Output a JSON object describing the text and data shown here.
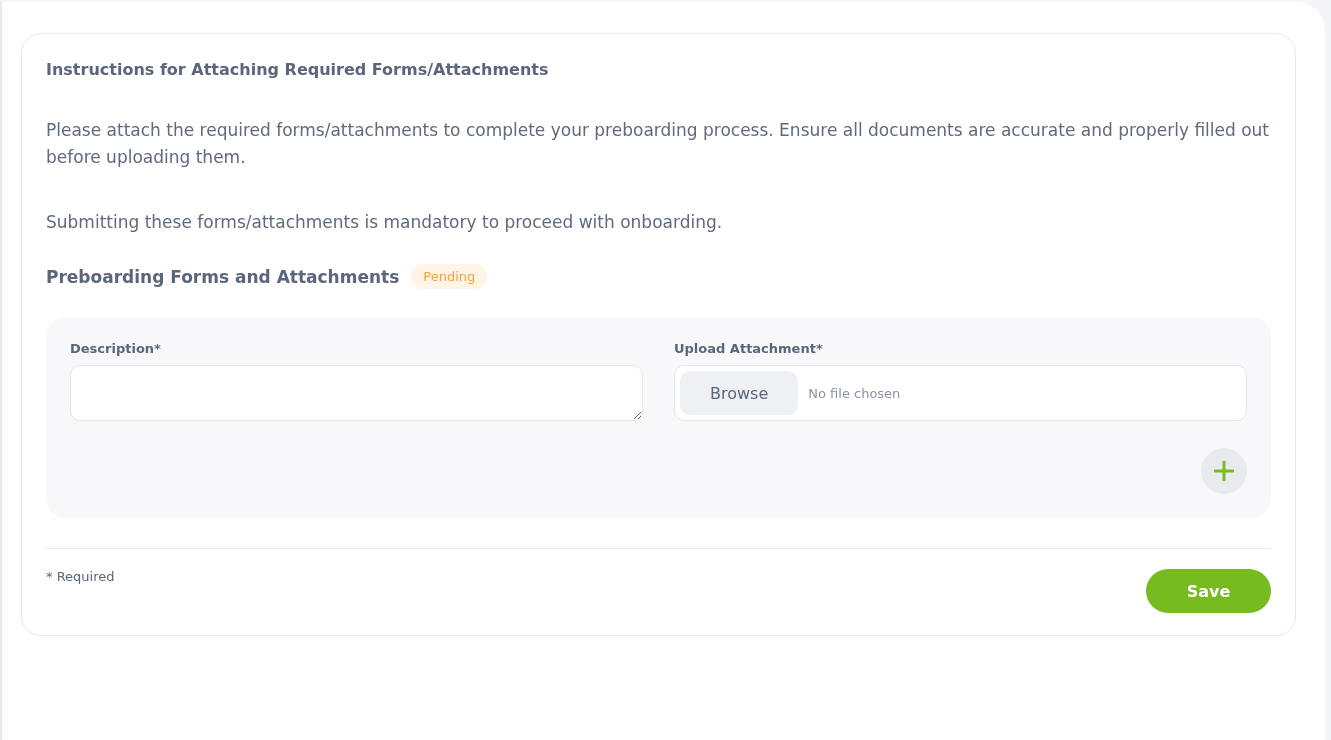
{
  "instructions": {
    "title": "Instructions for Attaching Required Forms/Attachments",
    "paragraphs": [
      "Please attach the required forms/attachments to complete your preboarding process. Ensure all documents are accurate and properly filled out before uploading them.",
      "Submitting these forms/attachments is mandatory to proceed with onboarding."
    ]
  },
  "section": {
    "title": "Preboarding Forms and Attachments",
    "status": {
      "label": "Pending",
      "kind": "pending"
    }
  },
  "form": {
    "description": {
      "label": "Description*"
    },
    "upload": {
      "label": "Upload Attachment*",
      "button": "Browse",
      "file_text": "No file chosen"
    }
  },
  "footer": {
    "note": "* Required",
    "save": "Save"
  }
}
